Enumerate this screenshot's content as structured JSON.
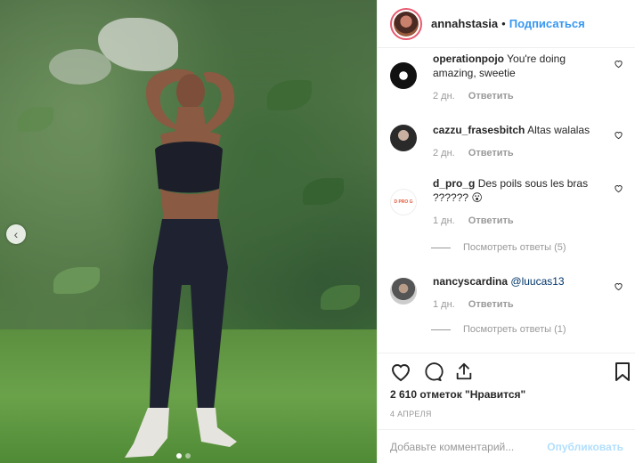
{
  "post": {
    "author": "annahstasia",
    "separator": "•",
    "follow_label": "Подписаться"
  },
  "comments": [
    {
      "user": "operationpojo",
      "text": "You're doing amazing, sweetie",
      "time": "2 дн.",
      "reply_label": "Ответить"
    },
    {
      "user": "cazzu_frasesbitch",
      "text": "Altas walalas",
      "time": "2 дн.",
      "reply_label": "Ответить"
    },
    {
      "user": "d_pro_g",
      "text": "Des poils sous les bras ?????? 😮",
      "time": "1 дн.",
      "reply_label": "Ответить",
      "view_replies": "Посмотреть ответы (5)",
      "avatar_text": "D PRO G"
    },
    {
      "user": "nancyscardina",
      "mention": "@luucas13",
      "time": "1 дн.",
      "reply_label": "Ответить",
      "view_replies": "Посмотреть ответы (1)"
    }
  ],
  "stats": {
    "likes": "2 610 отметок \"Нравится\"",
    "date": "4 АПРЕЛЯ"
  },
  "composer": {
    "placeholder": "Добавьте комментарий...",
    "post_label": "Опубликовать"
  },
  "carousel": {
    "prev_arrow": "‹"
  },
  "icons": [
    "heart-icon",
    "comment-icon",
    "share-icon",
    "bookmark-icon",
    "prev-arrow-icon"
  ]
}
